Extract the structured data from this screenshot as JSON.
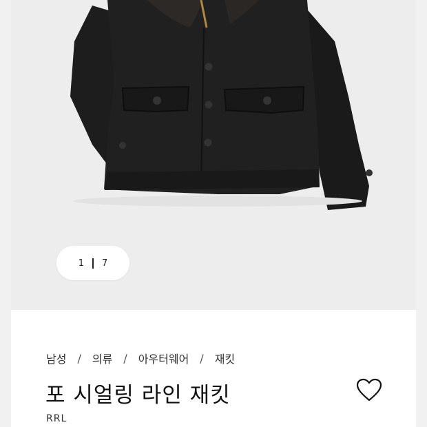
{
  "gallery": {
    "current_page": "1",
    "total_pages": "7"
  },
  "breadcrumb": {
    "items": [
      "남성",
      "의류",
      "아우터웨어",
      "재킷"
    ],
    "separator": "/"
  },
  "product": {
    "title": "포 시얼링 라인 재킷",
    "brand": "RRL"
  },
  "icons": {
    "wishlist": "heart-outline-icon"
  },
  "colors": {
    "background": "#f1f1f1",
    "image_background": "#ededed",
    "panel": "#ffffff",
    "jacket": "#1c1c1c",
    "text": "#111111"
  }
}
